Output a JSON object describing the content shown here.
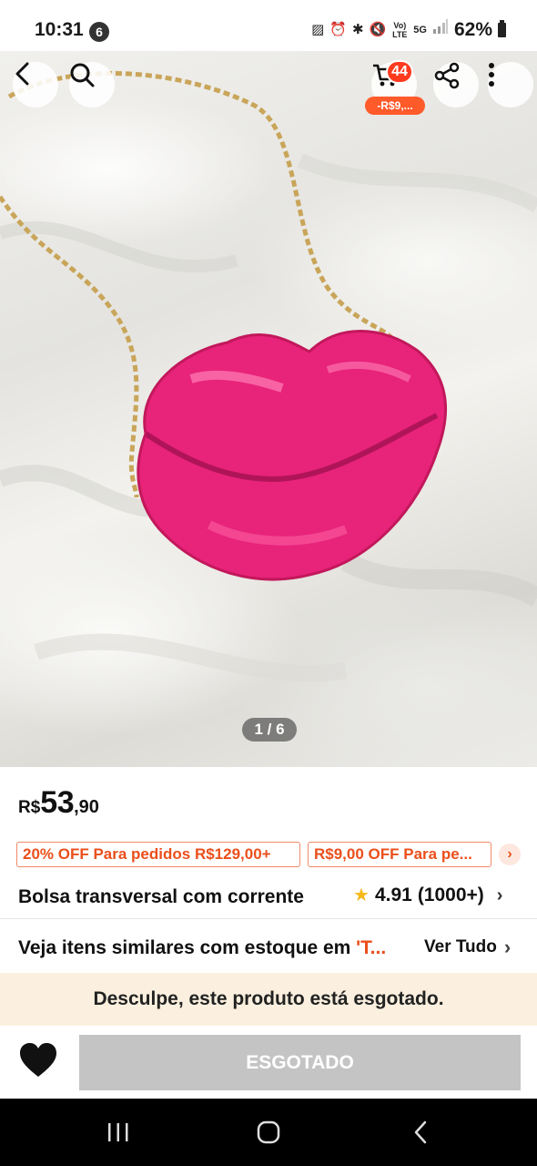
{
  "status_bar": {
    "time": "10:31",
    "notification_count": "6",
    "network_label_top": "Vo) LTE",
    "network_type": "5G",
    "battery_percent": "62%"
  },
  "image_overlay": {
    "cart_count": "44",
    "cart_discount": "-R$9,...",
    "image_counter": "1 / 6"
  },
  "product": {
    "price_currency": "R$",
    "price_integer": "53",
    "price_decimal": ",90",
    "promos": [
      {
        "label": "20% OFF Para pedidos R$129,00+"
      },
      {
        "label": "R$9,00 OFF Para pe..."
      }
    ],
    "title": "Bolsa transversal com corrente em forma de lábios, perfeita",
    "rating": "4.91",
    "rating_count": "(1000+)"
  },
  "similar": {
    "text": "Veja itens similares com estoque em ",
    "link": "'T...",
    "view_all": "Ver Tudo"
  },
  "sold_out_banner": "Desculpe, este produto está esgotado.",
  "bottom_bar": {
    "sold_out_button": "ESGOTADO"
  },
  "colors": {
    "accent": "#ea4f1c",
    "cart_badge": "#ff3b1f",
    "sold_out_button": "#c4c4c4",
    "banner_bg": "#fbf0df",
    "product_pink": "#e8237a"
  }
}
